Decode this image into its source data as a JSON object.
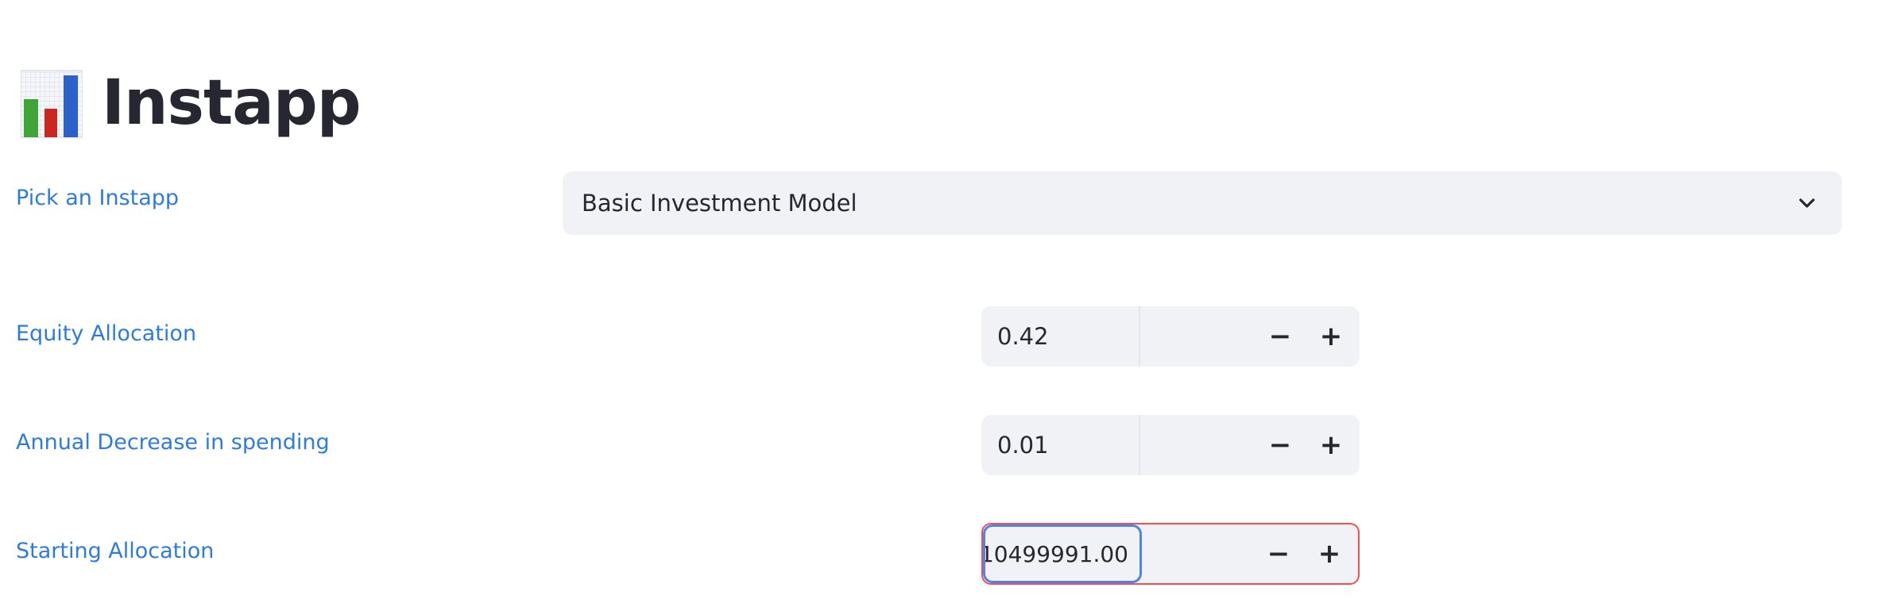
{
  "app": {
    "title": "Instapp",
    "icon": "bar-chart-icon"
  },
  "picker": {
    "label": "Pick an Instapp",
    "value": "Basic Investment Model",
    "icon": "chevron-down-icon"
  },
  "inputs": [
    {
      "label": "Equity Allocation",
      "value": "0.42",
      "minus": "−",
      "plus": "+"
    },
    {
      "label": "Annual Decrease in spending",
      "value": "0.01",
      "minus": "−",
      "plus": "+"
    },
    {
      "label": "Starting Allocation",
      "value": "10499991.00",
      "minus": "−",
      "plus": "+",
      "state": "error"
    }
  ],
  "colors": {
    "label": "#2e7be0",
    "title": "#262730",
    "input_bg": "#f0f2f6",
    "error_border": "#ff4b4b",
    "focus_border": "#4a86e8"
  }
}
